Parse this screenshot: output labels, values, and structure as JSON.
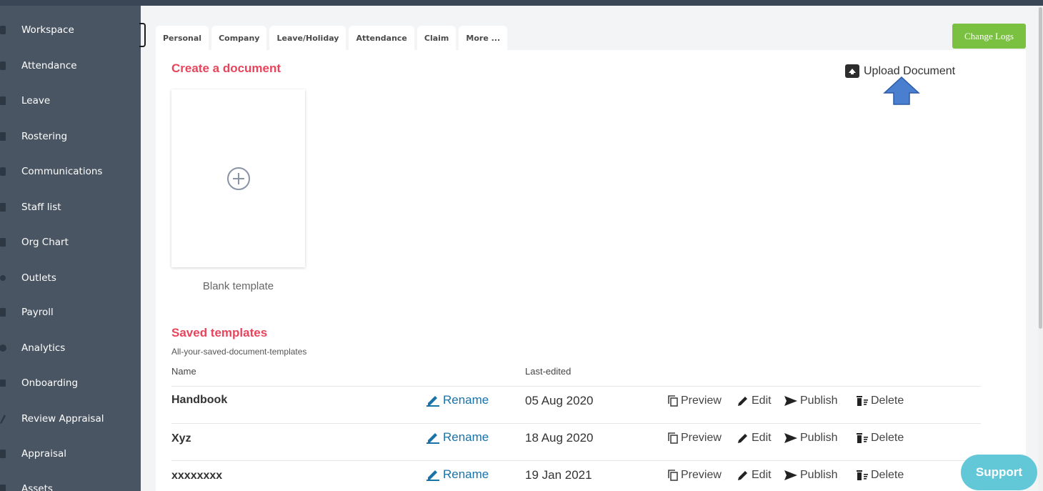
{
  "sidebar": {
    "items": [
      {
        "label": "Workspace",
        "icon": "workspace-icon"
      },
      {
        "label": "Attendance",
        "icon": "attendance-icon"
      },
      {
        "label": "Leave",
        "icon": "leave-icon"
      },
      {
        "label": "Rostering",
        "icon": "rostering-icon"
      },
      {
        "label": "Communications",
        "icon": "communications-icon"
      },
      {
        "label": "Staff list",
        "icon": "staff-list-icon"
      },
      {
        "label": "Org Chart",
        "icon": "org-chart-icon"
      },
      {
        "label": "Outlets",
        "icon": "outlets-icon"
      },
      {
        "label": "Payroll",
        "icon": "payroll-icon"
      },
      {
        "label": "Analytics",
        "icon": "analytics-icon"
      },
      {
        "label": "Onboarding",
        "icon": "onboarding-icon"
      },
      {
        "label": "Review Appraisal",
        "icon": "review-appraisal-icon"
      },
      {
        "label": "Appraisal",
        "icon": "appraisal-icon"
      },
      {
        "label": "Assets",
        "icon": "assets-icon"
      }
    ]
  },
  "tabs": [
    "Personal",
    "Company",
    "Leave/Holiday",
    "Attendance",
    "Claim",
    "More ..."
  ],
  "header": {
    "change_logs": "Change Logs"
  },
  "create": {
    "title": "Create a document",
    "blank_label": "Blank template"
  },
  "upload": {
    "label": "Upload Document"
  },
  "saved": {
    "title": "Saved templates",
    "subtitle": "All-your-saved-document-templates",
    "columns": {
      "name": "Name",
      "last_edited": "Last-edited"
    },
    "rows": [
      {
        "name": "Handbook",
        "date": "05 Aug 2020"
      },
      {
        "name": "Xyz",
        "date": "18 Aug 2020"
      },
      {
        "name": "xxxxxxxx",
        "date": "19 Jan 2021"
      }
    ],
    "actions": {
      "rename": "Rename",
      "preview": "Preview",
      "edit": "Edit",
      "publish": "Publish",
      "delete": "Delete"
    }
  },
  "support": {
    "label": "Support"
  },
  "colors": {
    "sidebar": "#4a5563",
    "accent_red": "#e8455d",
    "green": "#7ac142",
    "link_blue": "#1a73a8",
    "support": "#62c8d8",
    "arrow_blue": "#4a7fd0"
  }
}
